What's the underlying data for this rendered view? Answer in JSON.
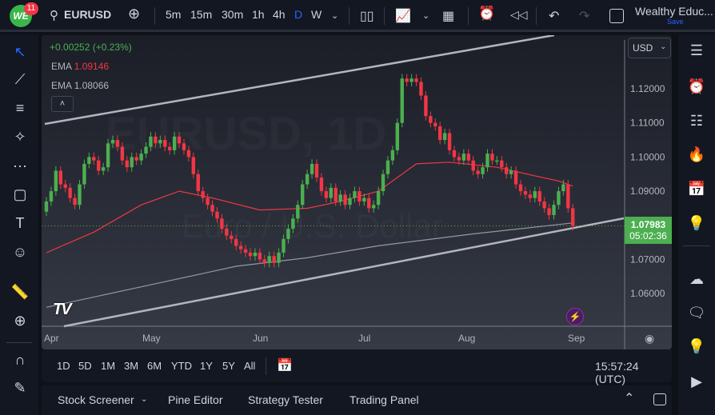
{
  "header": {
    "notifications": "11",
    "logo_text": "WE",
    "symbol": "EURUSD",
    "intervals": [
      "5m",
      "15m",
      "30m",
      "1h",
      "4h",
      "D",
      "W"
    ],
    "active_interval": "D",
    "account_name": "Wealthy Educ...",
    "save_label": "Save"
  },
  "legend": {
    "change": "+0.00252 (+0.23%)",
    "ema1_label": "EMA",
    "ema1_value": "1.09146",
    "ema2_label": "EMA",
    "ema2_value": "1.08066"
  },
  "watermark": {
    "line1": "EURUSD, 1D",
    "line2": "Euro / U.S. Dollar"
  },
  "currency": "USD",
  "colors": {
    "up": "#4caf50",
    "down": "#f23645",
    "ema_fast": "#f23645",
    "ema_slow": "#9598a1",
    "accent": "#2962ff"
  },
  "chart_data": {
    "type": "candlestick",
    "interval": "1D",
    "y_ticks": [
      "1.12000",
      "1.11000",
      "1.10000",
      "1.09000",
      "1.07000",
      "1.06000"
    ],
    "x_ticks": [
      "Apr",
      "May",
      "Jun",
      "Jul",
      "Aug",
      "Sep"
    ],
    "last_price": "1.07983",
    "countdown": "05:02:36",
    "first_open": 1.084,
    "close": [
      1.087,
      1.09,
      1.096,
      1.092,
      1.091,
      1.088,
      1.086,
      1.092,
      1.098,
      1.1,
      1.099,
      1.096,
      1.097,
      1.104,
      1.105,
      1.103,
      1.099,
      1.097,
      1.1,
      1.099,
      1.101,
      1.103,
      1.106,
      1.104,
      1.105,
      1.103,
      1.102,
      1.106,
      1.104,
      1.102,
      1.1,
      1.095,
      1.09,
      1.088,
      1.086,
      1.084,
      1.082,
      1.079,
      1.077,
      1.076,
      1.074,
      1.073,
      1.072,
      1.071,
      1.072,
      1.07,
      1.069,
      1.071,
      1.069,
      1.072,
      1.076,
      1.079,
      1.082,
      1.086,
      1.092,
      1.095,
      1.098,
      1.094,
      1.09,
      1.088,
      1.091,
      1.087,
      1.089,
      1.086,
      1.088,
      1.09,
      1.087,
      1.088,
      1.085,
      1.086,
      1.09,
      1.095,
      1.099,
      1.102,
      1.11,
      1.123,
      1.122,
      1.123,
      1.122,
      1.118,
      1.112,
      1.11,
      1.109,
      1.105,
      1.107,
      1.102,
      1.1,
      1.099,
      1.101,
      1.099,
      1.096,
      1.095,
      1.097,
      1.101,
      1.099,
      1.099,
      1.097,
      1.095,
      1.096,
      1.092,
      1.09,
      1.089,
      1.088,
      1.09,
      1.087,
      1.085,
      1.083,
      1.086,
      1.09,
      1.092,
      1.085,
      1.0798
    ],
    "ema_fast": [
      [
        0,
        1.072
      ],
      [
        10,
        1.078
      ],
      [
        20,
        1.086
      ],
      [
        28,
        1.09
      ],
      [
        35,
        1.088
      ],
      [
        45,
        1.0845
      ],
      [
        55,
        1.085
      ],
      [
        62,
        1.087
      ],
      [
        70,
        1.09
      ],
      [
        78,
        1.098
      ],
      [
        85,
        1.0985
      ],
      [
        95,
        1.097
      ],
      [
        103,
        1.0945
      ],
      [
        108,
        1.093
      ],
      [
        111,
        1.0915
      ]
    ],
    "ema_slow": [
      [
        0,
        1.056
      ],
      [
        20,
        1.062
      ],
      [
        40,
        1.068
      ],
      [
        55,
        1.0705
      ],
      [
        70,
        1.074
      ],
      [
        90,
        1.0775
      ],
      [
        111,
        1.0807
      ]
    ]
  },
  "range_buttons": [
    "1D",
    "5D",
    "1M",
    "3M",
    "6M",
    "YTD",
    "1Y",
    "5Y",
    "All"
  ],
  "clock": "15:57:24 (UTC)",
  "bottom_tabs": [
    "Stock Screener",
    "Pine Editor",
    "Strategy Tester",
    "Trading Panel"
  ]
}
